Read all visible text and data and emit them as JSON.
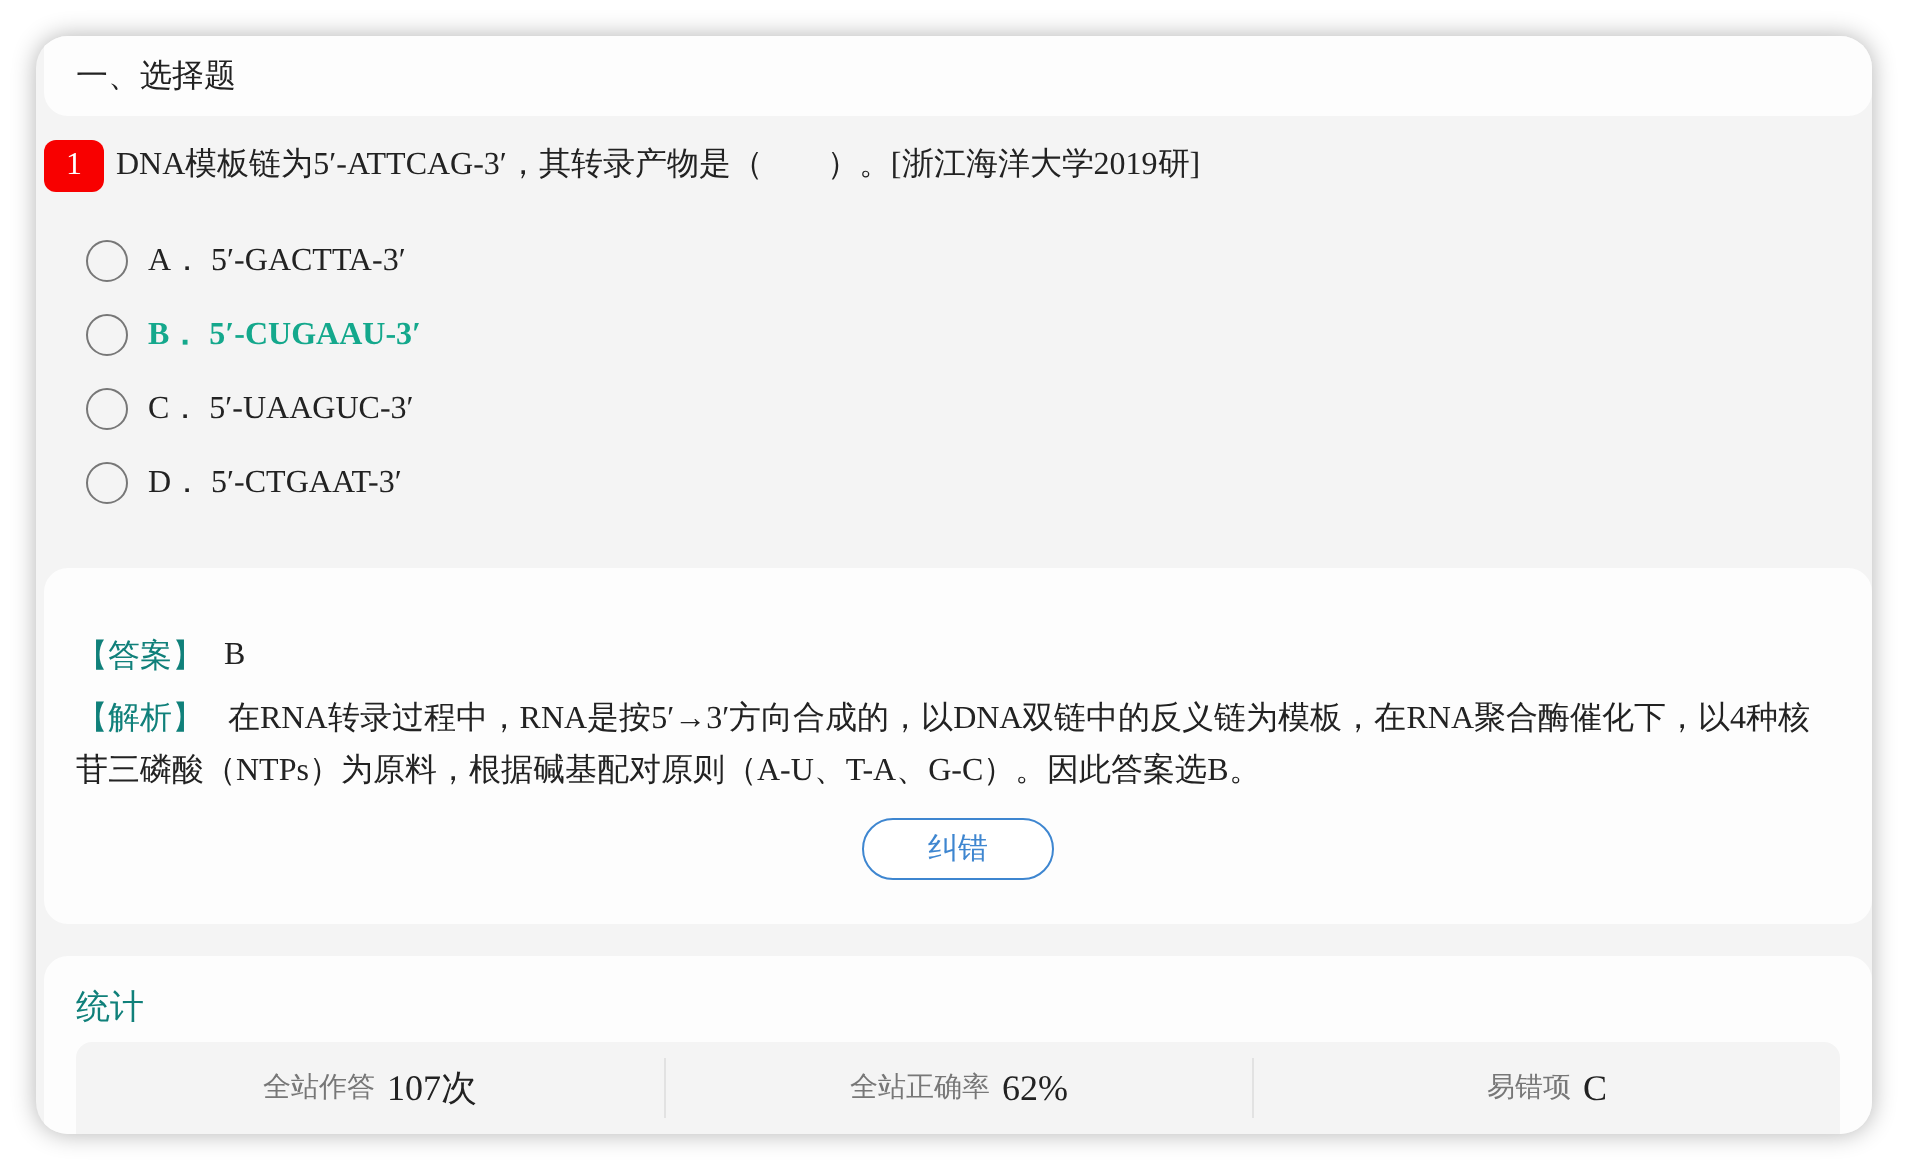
{
  "section_title": "一、选择题",
  "question": {
    "number": "1",
    "text": "DNA模板链为5′-ATTCAG-3′，其转录产物是（　　）。[浙江海洋大学2019研]"
  },
  "options": [
    {
      "letter": "A．",
      "text": "5′-GACTTA-3′",
      "selected": false,
      "correct": false
    },
    {
      "letter": "B．",
      "text": "5′-CUGAAU-3′",
      "selected": false,
      "correct": true
    },
    {
      "letter": "C．",
      "text": "5′-UAAGUC-3′",
      "selected": false,
      "correct": false
    },
    {
      "letter": "D．",
      "text": "5′-CTGAAT-3′",
      "selected": false,
      "correct": false
    }
  ],
  "answer": {
    "label": "【答案】",
    "value": "B"
  },
  "analysis": {
    "label": "【解析】",
    "text": "在RNA转录过程中，RNA是按5′→3′方向合成的，以DNA双链中的反义链为模板，在RNA聚合酶催化下，以4种核苷三磷酸（NTPs）为原料，根据碱基配对原则（A-U、T-A、G-C）。因此答案选B。"
  },
  "report_button": "纠错",
  "stats": {
    "title": "统计",
    "items": [
      {
        "label": "全站作答",
        "value": "107次"
      },
      {
        "label": "全站正确率",
        "value": "62%"
      },
      {
        "label": "易错项",
        "value": "C"
      }
    ]
  }
}
